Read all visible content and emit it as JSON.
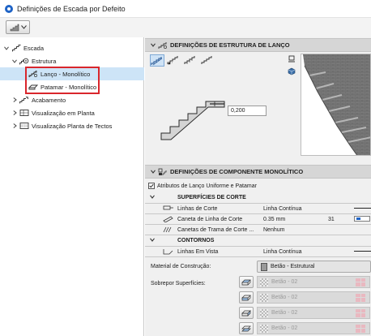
{
  "window": {
    "title": "Definições de Escada por Defeito"
  },
  "tree": {
    "items": [
      {
        "label": "Escada",
        "icon": "stair-icon",
        "chevron": "expanded"
      },
      {
        "label": "Estrutura",
        "icon": "structure-gear-icon",
        "chevron": "expanded"
      },
      {
        "label": "Lanço - Monolítico",
        "icon": "flight-icon",
        "chevron": "none",
        "selected": true
      },
      {
        "label": "Patamar - Monolítico",
        "icon": "landing-icon",
        "chevron": "none"
      },
      {
        "label": "Acabamento",
        "icon": "finish-icon",
        "chevron": "collapsed"
      },
      {
        "label": "Visualização em Planta",
        "icon": "floor-plan-icon",
        "chevron": "collapsed"
      },
      {
        "label": "Visualização Planta de Tectos",
        "icon": "ceiling-plan-icon",
        "chevron": "collapsed"
      }
    ]
  },
  "structure_section": {
    "title": "DEFINIÇÕES DE ESTRUTURA DE LANÇO",
    "icon": "flight-structure-icon",
    "type_buttons": [
      "stair-type-1-icon",
      "stair-type-2-icon",
      "stair-type-3-icon",
      "stair-type-4-icon"
    ],
    "thickness_value": "0,200"
  },
  "component_section": {
    "title": "DEFINIÇÕES DE COMPONENTE MONOLÍTICO",
    "icon": "monolithic-component-icon",
    "checkbox_label": "Atributos de Lanço Uniforme e Patamar",
    "checkbox_checked": true,
    "cut_header": "SUPERFÍCIES DE CORTE",
    "cut_rows": [
      {
        "label": "Linhas de Corte",
        "value": "Linha Contínua",
        "extra": "",
        "icon": "cut-line-icon"
      },
      {
        "label": "Caneta de Linha de Corte",
        "value": "0.35 mm",
        "extra": "31",
        "icon": "pen-icon"
      },
      {
        "label": "Canetas de Trama de Corte ...",
        "value": "Nenhum",
        "extra": "",
        "icon": "hatch-pen-icon"
      }
    ],
    "contours_header": "CONTORNOS",
    "contour_rows": [
      {
        "label": "Linhas Em Vista",
        "value": "Linha Contínua",
        "icon": "view-line-icon"
      }
    ],
    "material_label": "Material de Construção:",
    "material_value": "Betão - Estrutural",
    "overrides_label": "Sobrepor Superfícies:",
    "surface_rows": [
      {
        "value": "Betão - 02",
        "icon": "surface-top-icon"
      },
      {
        "value": "Betão - 02",
        "icon": "surface-side-icon"
      },
      {
        "value": "Betão - 02",
        "icon": "surface-edge-icon"
      },
      {
        "value": "Betão - 02",
        "icon": "surface-bottom-icon"
      }
    ]
  },
  "colors": {
    "selection": "#cde4f7",
    "highlight_box": "#d9262c",
    "section_header": "#d6d6d6",
    "accent": "#1e63c6"
  }
}
